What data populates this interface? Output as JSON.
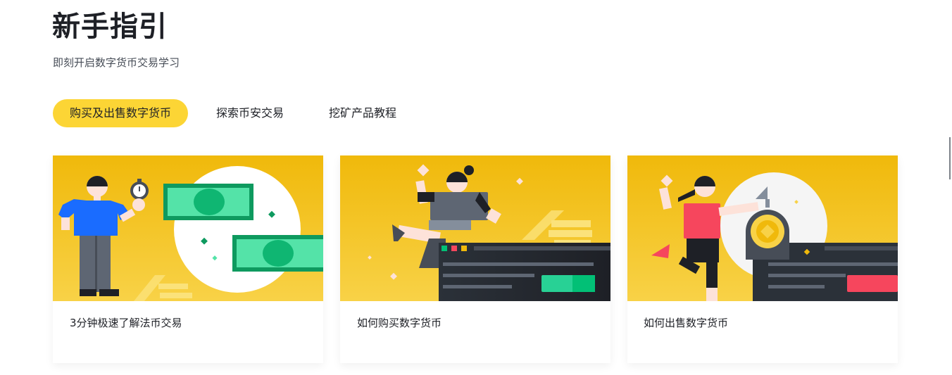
{
  "header": {
    "title": "新手指引",
    "subtitle": "即刻开启数字货币交易学习"
  },
  "tabs": [
    {
      "label": "购买及出售数字货币",
      "active": true
    },
    {
      "label": "探索币安交易",
      "active": false
    },
    {
      "label": "挖矿产品教程",
      "active": false
    }
  ],
  "cards": [
    {
      "title": "3分钟极速了解法币交易",
      "illustration": "person-stopwatch-banknotes-icon"
    },
    {
      "title": "如何购买数字货币",
      "illustration": "person-trading-terminal-icon"
    },
    {
      "title": "如何出售数字货币",
      "illustration": "person-coin-vault-icon"
    }
  ],
  "colors": {
    "accent": "#fcd535",
    "card_background": "#f3ba2f",
    "text_primary": "#1e2026",
    "text_secondary": "#474d57"
  }
}
